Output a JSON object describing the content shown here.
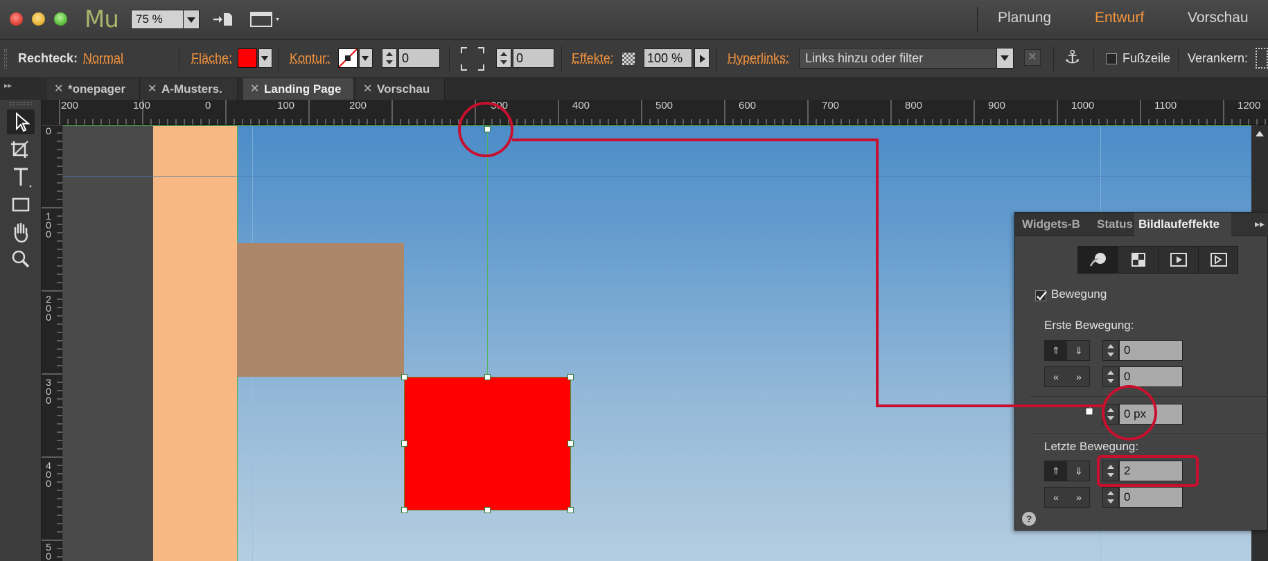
{
  "app": {
    "logo": "Mu",
    "zoom": "75 %",
    "nav": [
      "Planung",
      "Entwurf",
      "Vorschau"
    ],
    "active_nav": "Entwurf"
  },
  "control": {
    "object_label": "Rechteck:",
    "object_style": "Normal",
    "fill_label": "Fläche:",
    "fill_color": "#ff0000",
    "stroke_label": "Kontur:",
    "stroke_value": "0",
    "corner_value": "0",
    "effects_label": "Effekte:",
    "opacity": "100 %",
    "hyperlinks_label": "Hyperlinks:",
    "hyperlinks_placeholder": "Links hinzu oder filter",
    "footer_label": "Fußzeile",
    "anchor_label": "Verankern:"
  },
  "tabs": [
    {
      "label": "*onepager"
    },
    {
      "label": "A-Musters."
    },
    {
      "label": "Landing Page",
      "active": true
    },
    {
      "label": "Vorschau"
    }
  ],
  "ruler": {
    "h_labels": [
      "200",
      "100",
      "0",
      "100",
      "200",
      "300",
      "400",
      "500",
      "600",
      "700",
      "800",
      "900",
      "1000",
      "1100",
      "1200"
    ],
    "v_labels": [
      "0",
      "1\n0\n0",
      "2\n0\n0",
      "3\n0\n0",
      "4\n0\n0",
      "5\n0"
    ]
  },
  "panel": {
    "tabs": [
      "Widgets-B",
      "Status",
      "Bildlaufeffekte"
    ],
    "active_tab": "Bildlaufeffekte",
    "motion_checkbox": "Bewegung",
    "motion_checked": true,
    "first_motion_label": "Erste Bewegung:",
    "first_vertical": "0",
    "first_horizontal": "0",
    "key_position": "0 px",
    "last_motion_label": "Letzte Bewegung:",
    "last_vertical": "2",
    "last_horizontal": "0",
    "help": "?"
  },
  "colors": {
    "accent": "#f5943d",
    "callout": "#c8102e",
    "selection": "#ff0000"
  }
}
